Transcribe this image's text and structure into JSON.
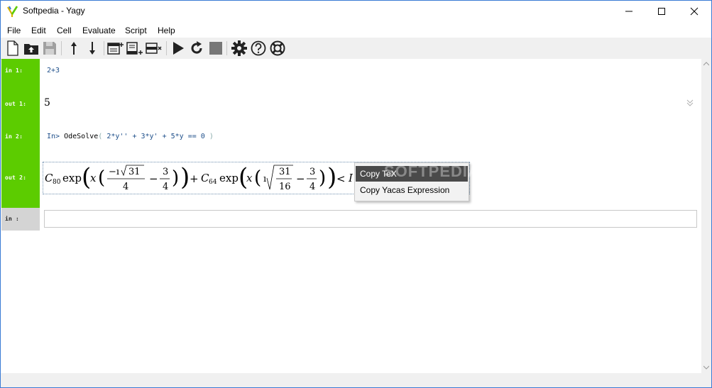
{
  "window": {
    "title": "Softpedia - Yagy"
  },
  "menu": {
    "items": [
      "File",
      "Edit",
      "Cell",
      "Evaluate",
      "Script",
      "Help"
    ]
  },
  "toolbar": {
    "icons": [
      "new-file-icon",
      "open-file-icon",
      "save-file-icon",
      "move-up-icon",
      "move-down-icon",
      "insert-cell-above-icon",
      "insert-cell-below-icon",
      "delete-cell-icon",
      "run-icon",
      "restart-icon",
      "stop-icon",
      "settings-icon",
      "help-icon",
      "support-icon"
    ]
  },
  "cells": {
    "in1": {
      "label": "in 1:",
      "code": "2+3"
    },
    "out1": {
      "label": "out 1:",
      "value": "5"
    },
    "in2": {
      "label": "in 2:",
      "prompt": "In>",
      "func": "OdeSolve",
      "paren_open": "(",
      "args": "2*y'' + 3*y' + 5*y == 0",
      "paren_close": ")"
    },
    "out2": {
      "label": "out 2:"
    },
    "in_empty": {
      "label": "in  :"
    }
  },
  "context_menu": {
    "items": [
      "Copy TeX",
      "Copy Yacas Expression"
    ],
    "active_index": 0
  },
  "watermark": "SOFTPEDIA",
  "colors": {
    "gutter": "#5ccc00",
    "gutter_empty": "#d4d4d4",
    "code": "#1e4f8a",
    "menu_active": "#4a4a4a"
  }
}
